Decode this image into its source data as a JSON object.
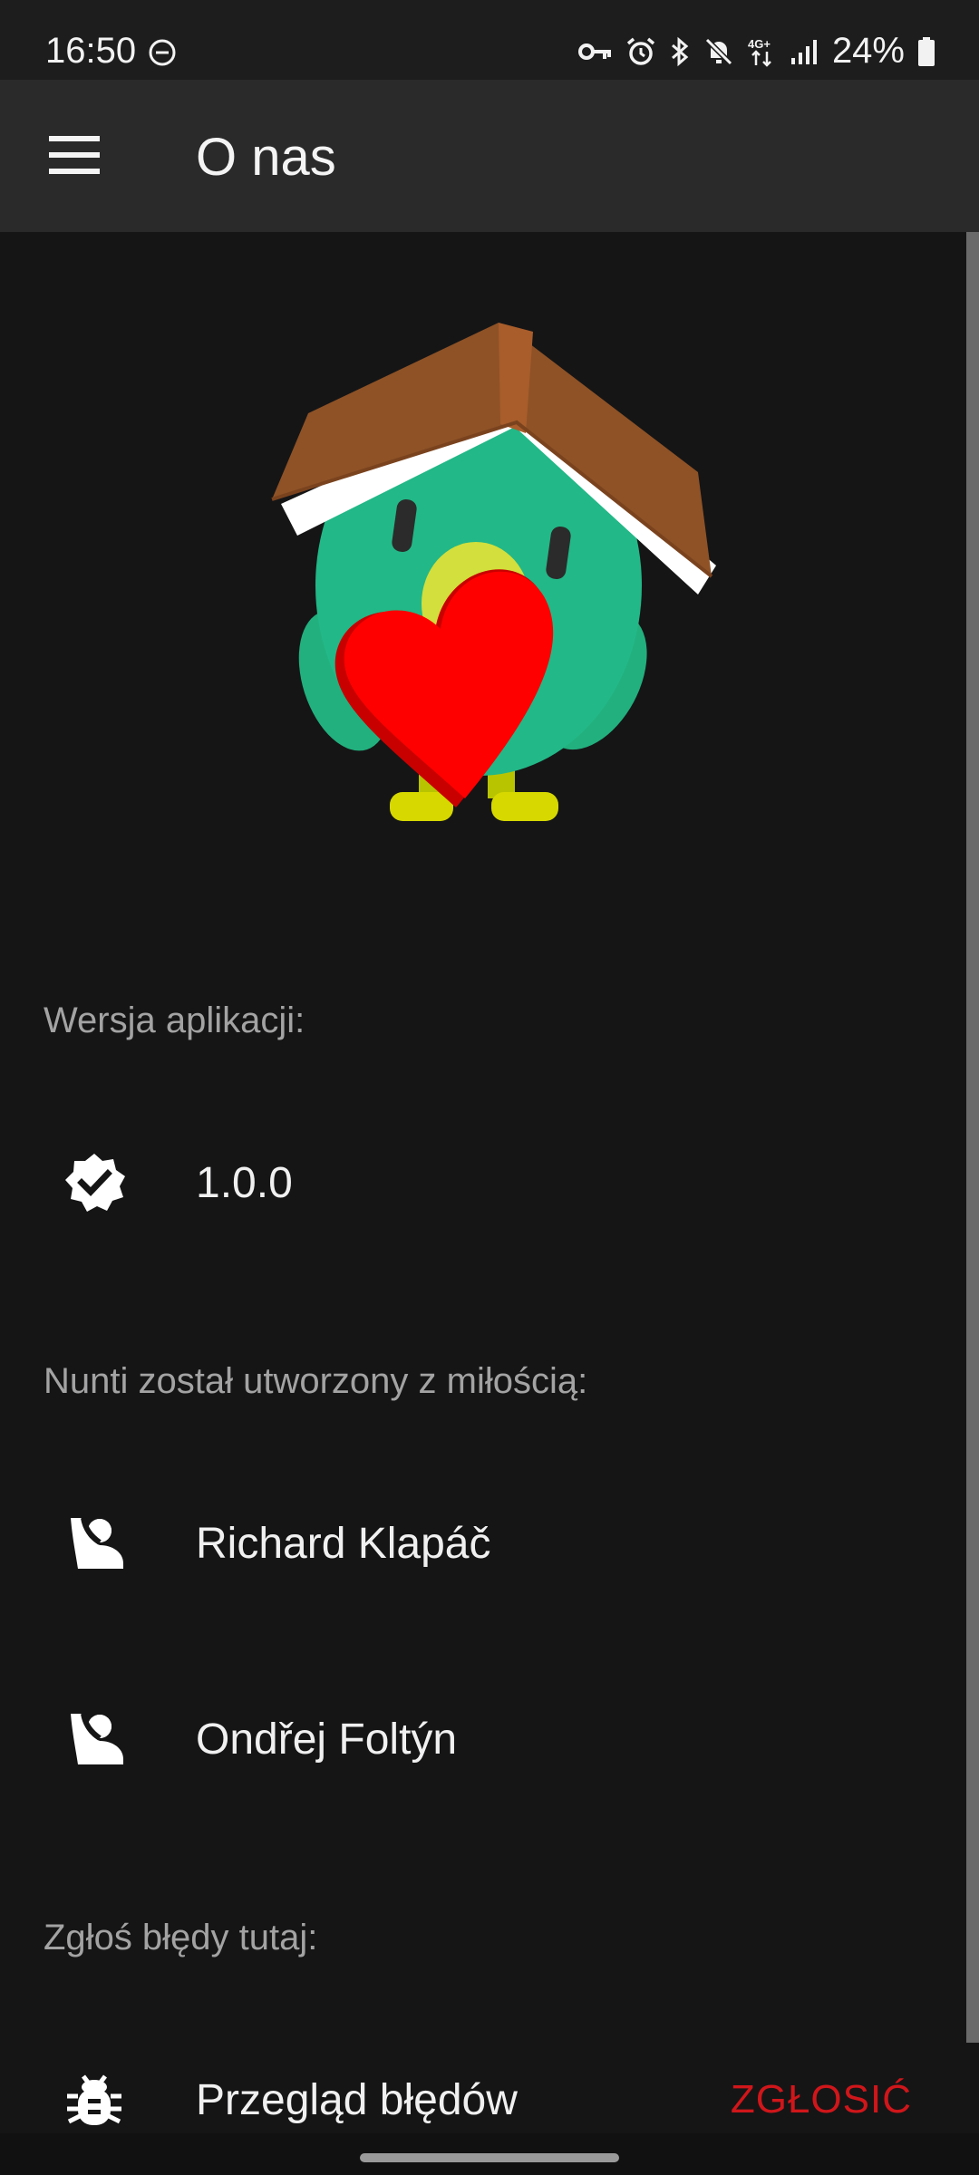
{
  "status_bar": {
    "time": "16:50",
    "battery": "24%",
    "icons": [
      "do-not-disturb-icon",
      "vpn-key-icon",
      "alarm-icon",
      "bluetooth-icon",
      "mute-icon",
      "4g-plus-icon",
      "signal-icon",
      "battery-icon"
    ]
  },
  "app_bar": {
    "title": "O nas",
    "menu_icon": "hamburger-menu-icon"
  },
  "sections": {
    "version_label": "Wersja aplikacji:",
    "version_value": "1.0.0",
    "version_icon": "verified-badge-icon",
    "authors_label": "Nunti został utworzony z miłością:",
    "authors": [
      {
        "name": "Richard Klapáč",
        "icon": "person-icon"
      },
      {
        "name": "Ondřej Foltýn",
        "icon": "person-icon"
      }
    ],
    "bugs_label": "Zgłoś błędy tutaj:",
    "bug_row": {
      "label": "Przegląd błędów",
      "action": "ZGŁOSIĆ",
      "icon": "bug-icon"
    }
  },
  "colors": {
    "background": "#151516",
    "app_bar": "#2a2a2b",
    "accent_action": "#d0161a",
    "label_gray": "#a3a3a3"
  }
}
